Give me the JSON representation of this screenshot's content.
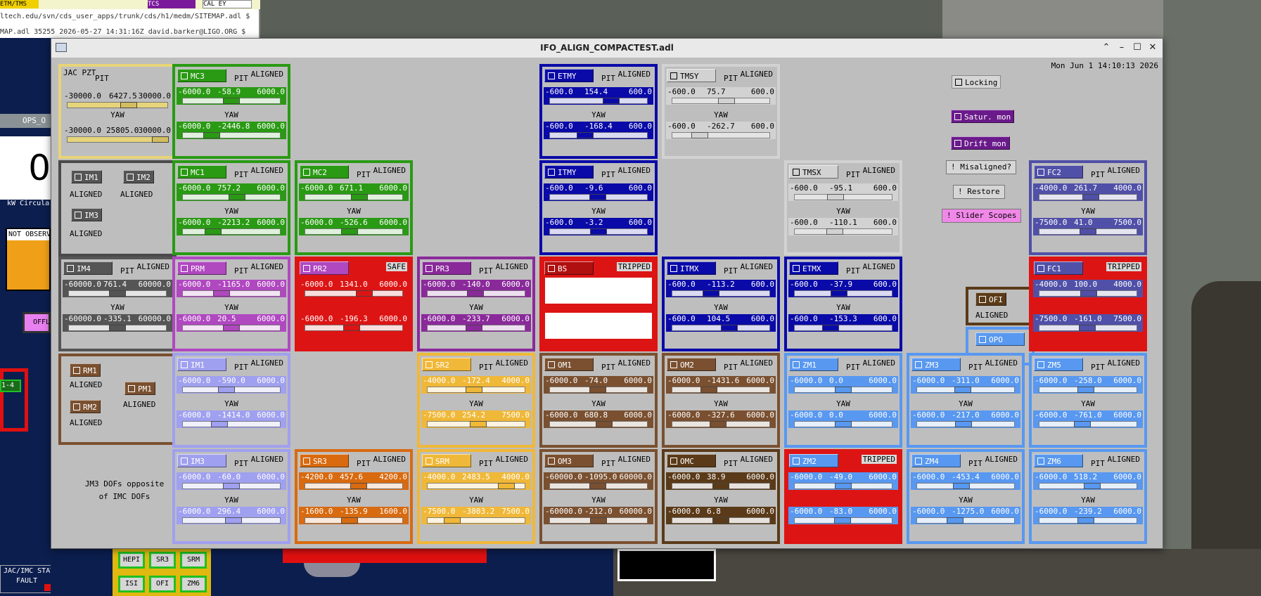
{
  "bg": {
    "line1": "ltech.edu/svn/cds_user_apps/trunk/cds/h1/medm/SITEMAP.adl $",
    "line2": "MAP.adl 35255 2026-05-27 14:31:16Z david.barker@LIGO.ORG $",
    "tab1": "ETM/TMS",
    "tab2": "TCS",
    "tab3": "CAL EY",
    "ops": "OPS_O",
    "bignum": "0",
    "circ": "kW Circula",
    "notobs": "NOT OBSERV",
    "offl": "OFFL",
    "box14": "1-4",
    "state": "JAC/IMC STATE",
    "fault": "FAULT",
    "btns": [
      "HEPI",
      "SR3",
      "SRM",
      "ISI",
      "OFI",
      "ZM6"
    ]
  },
  "window": {
    "title": "IFO_ALIGN_COMPACTEST.adl",
    "clock": "Mon Jun  1 14:10:13 2026"
  },
  "panels": [
    {
      "label": "MC3",
      "col": 0,
      "row": 0,
      "color": "#2a9a14",
      "status": "ALIGNED",
      "stype": "norm",
      "p": [
        "-6000.0",
        "-58.9",
        "6000.0"
      ],
      "y": [
        "-6000.0",
        "-2446.8",
        "6000.0"
      ],
      "pp": 0.5,
      "yp": 0.3
    },
    {
      "label": "ETMY",
      "col": 3,
      "row": 0,
      "color": "#0a0aa8",
      "status": "ALIGNED",
      "stype": "norm",
      "p": [
        "-600.0",
        "154.4",
        "600.0"
      ],
      "y": [
        "-600.0",
        "-168.4",
        "600.0"
      ],
      "pp": 0.63,
      "yp": 0.36
    },
    {
      "label": "TMSY",
      "col": 4,
      "row": 0,
      "color": "#d2d2d2",
      "status": "ALIGNED",
      "stype": "norm",
      "dark": true,
      "p": [
        "-600.0",
        "75.7",
        "600.0"
      ],
      "y": [
        "-600.0",
        "-262.7",
        "600.0"
      ],
      "pp": 0.56,
      "yp": 0.28
    },
    {
      "label": "MC1",
      "col": 0,
      "row": 1,
      "color": "#2a9a14",
      "status": "ALIGNED",
      "stype": "norm",
      "p": [
        "-6000.0",
        "757.2",
        "6000.0"
      ],
      "y": [
        "-6000.0",
        "-2213.2",
        "6000.0"
      ],
      "pp": 0.56,
      "yp": 0.31
    },
    {
      "label": "MC2",
      "col": 1,
      "row": 1,
      "color": "#2a9a14",
      "status": "ALIGNED",
      "stype": "norm",
      "p": [
        "-6000.0",
        "671.1",
        "6000.0"
      ],
      "y": [
        "-6000.0",
        "-526.6",
        "6000.0"
      ],
      "pp": 0.56,
      "yp": 0.46
    },
    {
      "label": "ITMY",
      "col": 3,
      "row": 1,
      "color": "#0a0aa8",
      "status": "ALIGNED",
      "stype": "norm",
      "p": [
        "-600.0",
        "-9.6",
        "600.0"
      ],
      "y": [
        "-600.0",
        "-3.2",
        "600.0"
      ],
      "pp": 0.49,
      "yp": 0.5
    },
    {
      "label": "TMSX",
      "col": 5,
      "row": 1,
      "color": "#d2d2d2",
      "status": "ALIGNED",
      "stype": "norm",
      "dark": true,
      "p": [
        "-600.0",
        "-95.1",
        "600.0"
      ],
      "y": [
        "-600.0",
        "-110.1",
        "600.0"
      ],
      "pp": 0.42,
      "yp": 0.41
    },
    {
      "label": "FC2",
      "col": 8,
      "row": 1,
      "color": "#5050a8",
      "status": "ALIGNED",
      "stype": "norm",
      "p": [
        "-4000.0",
        "261.7",
        "4000.0"
      ],
      "y": [
        "-7500.0",
        "41.0",
        "7500.0"
      ],
      "pp": 0.53,
      "yp": 0.5
    },
    {
      "label": "IM4",
      "col": -1,
      "row": 2,
      "color": "#555555",
      "status": "ALIGNED",
      "stype": "norm",
      "dark2": true,
      "p": [
        "-60000.0",
        "761.4",
        "60000.0"
      ],
      "y": [
        "-60000.0",
        "-335.1",
        "60000.0"
      ],
      "pp": 0.5,
      "yp": 0.5
    },
    {
      "label": "PRM",
      "col": 0,
      "row": 2,
      "color": "#b048c0",
      "status": "ALIGNED",
      "stype": "norm",
      "p": [
        "-6000.0",
        "-1165.0",
        "6000.0"
      ],
      "y": [
        "-6000.0",
        "20.5",
        "6000.0"
      ],
      "pp": 0.4,
      "yp": 0.5
    },
    {
      "label": "PR2",
      "col": 1,
      "row": 2,
      "color": "#dd1414",
      "status": "SAFE",
      "stype": "box",
      "btn": "#b048c0",
      "p": [
        "-6000.0",
        "1341.0",
        "6000.0"
      ],
      "y": [
        "-6000.0",
        "-196.3",
        "6000.0"
      ],
      "pp": 0.61,
      "yp": 0.48
    },
    {
      "label": "PR3",
      "col": 2,
      "row": 2,
      "color": "#8a2a9a",
      "status": "ALIGNED",
      "stype": "norm",
      "p": [
        "-6000.0",
        "-140.0",
        "6000.0"
      ],
      "y": [
        "-6000.0",
        "-233.7",
        "6000.0"
      ],
      "pp": 0.49,
      "yp": 0.48
    },
    {
      "label": "BS",
      "col": 3,
      "row": 2,
      "color": "#dd1414",
      "status": "TRIPPED",
      "stype": "box",
      "btn": "#b01010",
      "blank": true
    },
    {
      "label": "ITMX",
      "col": 4,
      "row": 2,
      "color": "#0a0aa8",
      "status": "ALIGNED",
      "stype": "norm",
      "p": [
        "-600.0",
        "-113.2",
        "600.0"
      ],
      "y": [
        "-600.0",
        "104.5",
        "600.0"
      ],
      "pp": 0.4,
      "yp": 0.59
    },
    {
      "label": "ETMX",
      "col": 5,
      "row": 2,
      "color": "#0a0aa8",
      "status": "ALIGNED",
      "stype": "norm",
      "p": [
        "-600.0",
        "-37.9",
        "600.0"
      ],
      "y": [
        "-600.0",
        "-153.3",
        "600.0"
      ],
      "pp": 0.46,
      "yp": 0.37
    },
    {
      "label": "FC1",
      "col": 8,
      "row": 2,
      "color": "#dd1414",
      "status": "TRIPPED",
      "stype": "box",
      "btn": "#5050a8",
      "inner": "#5050a8",
      "p": [
        "-4000.0",
        "100.0",
        "4000.0"
      ],
      "y": [
        "-7500.0",
        "-161.0",
        "7500.0"
      ],
      "pp": 0.51,
      "yp": 0.49
    },
    {
      "label": "IM1",
      "col": 0,
      "row": 3,
      "color": "#a0a0f0",
      "status": "ALIGNED",
      "stype": "norm",
      "p": [
        "-6000.0",
        "-590.0",
        "6000.0"
      ],
      "y": [
        "-6000.0",
        "-1414.0",
        "6000.0"
      ],
      "pp": 0.45,
      "yp": 0.38
    },
    {
      "label": "SR2",
      "col": 2,
      "row": 3,
      "color": "#f0b838",
      "status": "ALIGNED",
      "stype": "norm",
      "p": [
        "-4000.0",
        "-172.4",
        "4000.0"
      ],
      "y": [
        "-7500.0",
        "254.2",
        "7500.0"
      ],
      "pp": 0.48,
      "yp": 0.52
    },
    {
      "label": "OM1",
      "col": 3,
      "row": 3,
      "color": "#7a5030",
      "status": "ALIGNED",
      "stype": "norm",
      "p": [
        "-6000.0",
        "-74.0",
        "6000.0"
      ],
      "y": [
        "-6000.0",
        "680.8",
        "6000.0"
      ],
      "pp": 0.49,
      "yp": 0.56
    },
    {
      "label": "OM2",
      "col": 4,
      "row": 3,
      "color": "#7a5030",
      "status": "ALIGNED",
      "stype": "norm",
      "p": [
        "-6000.0",
        "-1431.6",
        "6000.0"
      ],
      "y": [
        "-6000.0",
        "-327.6",
        "6000.0"
      ],
      "pp": 0.38,
      "yp": 0.47
    },
    {
      "label": "ZM1",
      "col": 5,
      "row": 3,
      "color": "#5898f0",
      "status": "ALIGNED",
      "stype": "norm",
      "p": [
        "-6000.0",
        "0.0",
        "6000.0"
      ],
      "y": [
        "-6000.0",
        "0.0",
        "6000.0"
      ],
      "pp": 0.5,
      "yp": 0.5
    },
    {
      "label": "ZM3",
      "col": 6,
      "row": 3,
      "color": "#5898f0",
      "status": "ALIGNED",
      "stype": "norm",
      "p": [
        "-6000.0",
        "-311.0",
        "6000.0"
      ],
      "y": [
        "-6000.0",
        "-217.0",
        "6000.0"
      ],
      "pp": 0.47,
      "yp": 0.48
    },
    {
      "label": "ZM5",
      "col": 8,
      "row": 3,
      "color": "#5898f0",
      "status": "ALIGNED",
      "stype": "norm",
      "p": [
        "-6000.0",
        "-258.0",
        "6000.0"
      ],
      "y": [
        "-6000.0",
        "-761.0",
        "6000.0"
      ],
      "pp": 0.48,
      "yp": 0.44
    },
    {
      "label": "IM3",
      "col": 0,
      "row": 4,
      "color": "#a0a0f0",
      "status": "ALIGNED",
      "stype": "norm",
      "p": [
        "-6000.0",
        "-60.0",
        "6000.0"
      ],
      "y": [
        "-6000.0",
        "296.4",
        "6000.0"
      ],
      "pp": 0.5,
      "yp": 0.52
    },
    {
      "label": "SR3",
      "col": 1,
      "row": 4,
      "color": "#d86a10",
      "status": "ALIGNED",
      "stype": "norm",
      "p": [
        "-4200.0",
        "457.6",
        "4200.0"
      ],
      "y": [
        "-1600.0",
        "-135.9",
        "1600.0"
      ],
      "pp": 0.55,
      "yp": 0.46
    },
    {
      "label": "SRM",
      "col": 2,
      "row": 4,
      "color": "#f0b838",
      "status": "ALIGNED",
      "stype": "norm",
      "p": [
        "-4000.0",
        "2483.5",
        "4000.0"
      ],
      "y": [
        "-7500.0",
        "-3803.2",
        "7500.0"
      ],
      "pp": 0.81,
      "yp": 0.25
    },
    {
      "label": "OM3",
      "col": 3,
      "row": 4,
      "color": "#7a5030",
      "status": "ALIGNED",
      "stype": "norm",
      "p": [
        "-60000.0",
        "-1095.0",
        "60000.0"
      ],
      "y": [
        "-60000.0",
        "-212.0",
        "60000.0"
      ],
      "pp": 0.49,
      "yp": 0.5
    },
    {
      "label": "OMC",
      "col": 4,
      "row": 4,
      "color": "#5a3a18",
      "status": "ALIGNED",
      "stype": "norm",
      "p": [
        "-6000.0",
        "38.9",
        "6000.0"
      ],
      "y": [
        "-6000.0",
        "6.8",
        "6000.0"
      ],
      "pp": 0.5,
      "yp": 0.5
    },
    {
      "label": "ZM2",
      "col": 5,
      "row": 4,
      "color": "#dd1414",
      "status": "TRIPPED",
      "stype": "box",
      "btn": "#5898f0",
      "inner": "#5898f0",
      "p": [
        "-6000.0",
        "-49.0",
        "6000.0"
      ],
      "y": [
        "-6000.0",
        "-83.0",
        "6000.0"
      ],
      "pp": 0.5,
      "yp": 0.49
    },
    {
      "label": "ZM4",
      "col": 6,
      "row": 4,
      "color": "#5898f0",
      "status": "ALIGNED",
      "stype": "norm",
      "p": [
        "-6000.0",
        "-453.4",
        "6000.0"
      ],
      "y": [
        "-6000.0",
        "-1275.0",
        "6000.0"
      ],
      "pp": 0.46,
      "yp": 0.39
    },
    {
      "label": "ZM6",
      "col": 8,
      "row": 4,
      "color": "#5898f0",
      "status": "ALIGNED",
      "stype": "norm",
      "p": [
        "-6000.0",
        "518.2",
        "6000.0"
      ],
      "y": [
        "-6000.0",
        "-239.2",
        "6000.0"
      ],
      "pp": 0.54,
      "yp": 0.48
    }
  ],
  "jac": {
    "title": "JAC PZT",
    "pit": "PIT",
    "p": [
      "-30000.0",
      "6427.5",
      "30000.0"
    ],
    "y": [
      "-30000.0",
      "25805.0",
      "30000.0"
    ],
    "yaw": "YAW",
    "pp": 0.61,
    "yp": 0.93
  },
  "imbox": {
    "im1": "IM1",
    "im2": "IM2",
    "im3": "IM3",
    "aligned": "ALIGNED"
  },
  "rmbox": {
    "rm1": "RM1",
    "rm2": "RM2",
    "pm1": "PM1",
    "aligned": "ALIGNED"
  },
  "ofi": {
    "ofi": "OFI",
    "opo": "OPO",
    "aligned": "ALIGNED"
  },
  "note": {
    "l1": "JM3 DOFs opposite",
    "l2": "of IMC DOFs"
  },
  "labels": {
    "pit": "PIT",
    "yaw": "YAW"
  },
  "controls": {
    "locking": "Locking",
    "satur": "Satur. mon",
    "drift": "Drift mon",
    "misaligned": "! Misaligned?",
    "restore": "! Restore",
    "scopes": "! Slider Scopes"
  }
}
